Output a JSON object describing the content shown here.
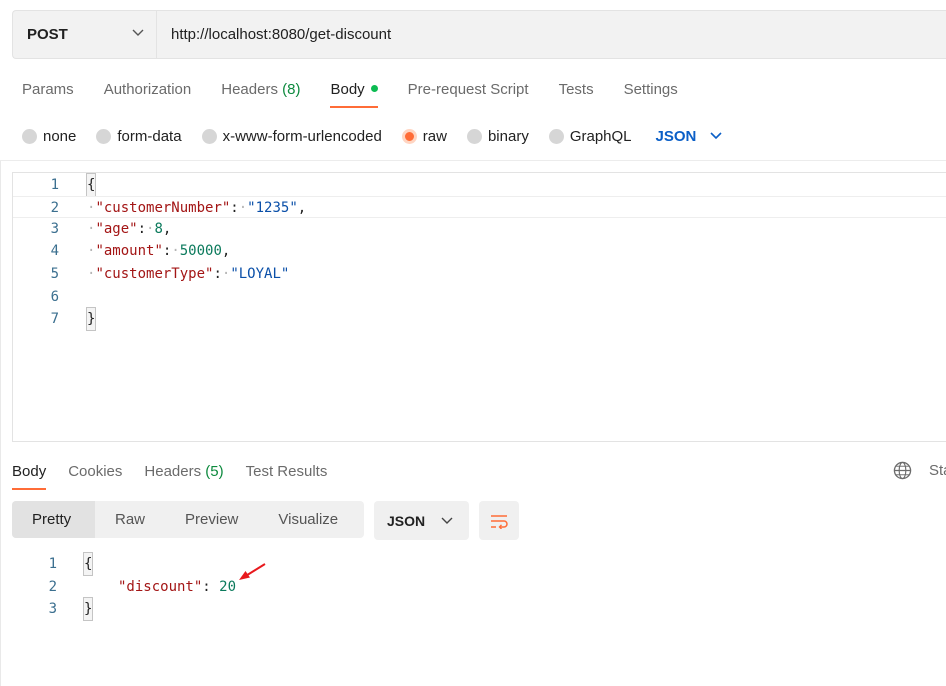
{
  "request": {
    "method": "POST",
    "url": "http://localhost:8080/get-discount"
  },
  "request_tabs": [
    {
      "label": "Params"
    },
    {
      "label": "Authorization"
    },
    {
      "label": "Headers",
      "count": "(8)"
    },
    {
      "label": "Body",
      "active": true
    },
    {
      "label": "Pre-request Script"
    },
    {
      "label": "Tests"
    },
    {
      "label": "Settings"
    }
  ],
  "body_types": {
    "none": "none",
    "form_data": "form-data",
    "urlencoded": "x-www-form-urlencoded",
    "raw": "raw",
    "binary": "binary",
    "graphql": "GraphQL",
    "language": "JSON"
  },
  "request_body": {
    "line_numbers": [
      "1",
      "2",
      "3",
      "4",
      "5",
      "6",
      "7"
    ],
    "open": "{",
    "close": "}",
    "fields": [
      {
        "key": "\"customerNumber\"",
        "value": "\"1235\"",
        "kind": "string",
        "comma": ","
      },
      {
        "key": "\"age\"",
        "value": "8",
        "kind": "number",
        "comma": ","
      },
      {
        "key": "\"amount\"",
        "value": "50000",
        "kind": "number",
        "comma": ","
      },
      {
        "key": "\"customerType\"",
        "value": "\"LOYAL\"",
        "kind": "string",
        "comma": ""
      }
    ]
  },
  "response_tabs": {
    "body": "Body",
    "cookies": "Cookies",
    "headers": "Headers",
    "headers_count": "(5)",
    "test_results": "Test Results",
    "status_partial": "Sta"
  },
  "format_bar": {
    "modes": [
      "Pretty",
      "Raw",
      "Preview",
      "Visualize"
    ],
    "active": "Pretty",
    "language": "JSON"
  },
  "response_body": {
    "line_numbers": [
      "1",
      "2",
      "3"
    ],
    "open": "{",
    "close": "}",
    "key": "\"discount\"",
    "value": "20"
  },
  "colors": {
    "accent": "#ff6c37",
    "json_link": "#0b5fc7",
    "active_dot": "#0cbb52",
    "annotation_arrow": "#e8191d"
  },
  "icons": [
    "chevron-down-icon",
    "globe-icon",
    "wrap-lines-icon",
    "red-arrow-icon"
  ]
}
